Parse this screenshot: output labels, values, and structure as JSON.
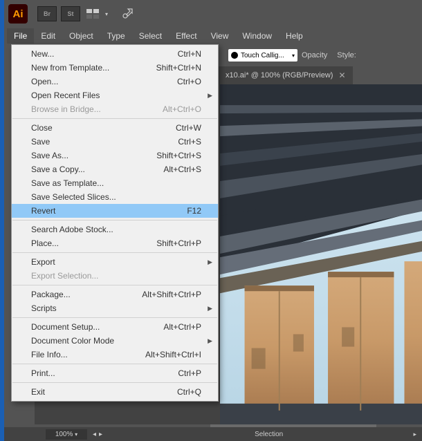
{
  "titlebar": {
    "logo_text": "Ai",
    "icons": {
      "br": "Br",
      "st": "St"
    }
  },
  "menubar": {
    "file": "File",
    "edit": "Edit",
    "object": "Object",
    "type": "Type",
    "select": "Select",
    "effect": "Effect",
    "view": "View",
    "window": "Window",
    "help": "Help"
  },
  "file_menu": {
    "new": {
      "label": "New...",
      "shortcut": "Ctrl+N"
    },
    "new_template": {
      "label": "New from Template...",
      "shortcut": "Shift+Ctrl+N"
    },
    "open": {
      "label": "Open...",
      "shortcut": "Ctrl+O"
    },
    "open_recent": {
      "label": "Open Recent Files",
      "shortcut": ""
    },
    "browse_bridge": {
      "label": "Browse in Bridge...",
      "shortcut": "Alt+Ctrl+O"
    },
    "close": {
      "label": "Close",
      "shortcut": "Ctrl+W"
    },
    "save": {
      "label": "Save",
      "shortcut": "Ctrl+S"
    },
    "save_as": {
      "label": "Save As...",
      "shortcut": "Shift+Ctrl+S"
    },
    "save_copy": {
      "label": "Save a Copy...",
      "shortcut": "Alt+Ctrl+S"
    },
    "save_template": {
      "label": "Save as Template...",
      "shortcut": ""
    },
    "save_slices": {
      "label": "Save Selected Slices...",
      "shortcut": ""
    },
    "revert": {
      "label": "Revert",
      "shortcut": "F12"
    },
    "search_stock": {
      "label": "Search Adobe Stock...",
      "shortcut": ""
    },
    "place": {
      "label": "Place...",
      "shortcut": "Shift+Ctrl+P"
    },
    "export": {
      "label": "Export",
      "shortcut": ""
    },
    "export_selection": {
      "label": "Export Selection...",
      "shortcut": ""
    },
    "package": {
      "label": "Package...",
      "shortcut": "Alt+Shift+Ctrl+P"
    },
    "scripts": {
      "label": "Scripts",
      "shortcut": ""
    },
    "doc_setup": {
      "label": "Document Setup...",
      "shortcut": "Alt+Ctrl+P"
    },
    "color_mode": {
      "label": "Document Color Mode",
      "shortcut": ""
    },
    "file_info": {
      "label": "File Info...",
      "shortcut": "Alt+Shift+Ctrl+I"
    },
    "print": {
      "label": "Print...",
      "shortcut": "Ctrl+P"
    },
    "exit": {
      "label": "Exit",
      "shortcut": "Ctrl+Q"
    }
  },
  "toolbar2": {
    "brush_name": "Touch Callig...",
    "opacity_label": "Opacity",
    "style_label": "Style:"
  },
  "document": {
    "tab_title": "x10.ai* @ 100% (RGB/Preview)"
  },
  "statusbar": {
    "zoom": "100%",
    "selection_label": "Selection"
  }
}
